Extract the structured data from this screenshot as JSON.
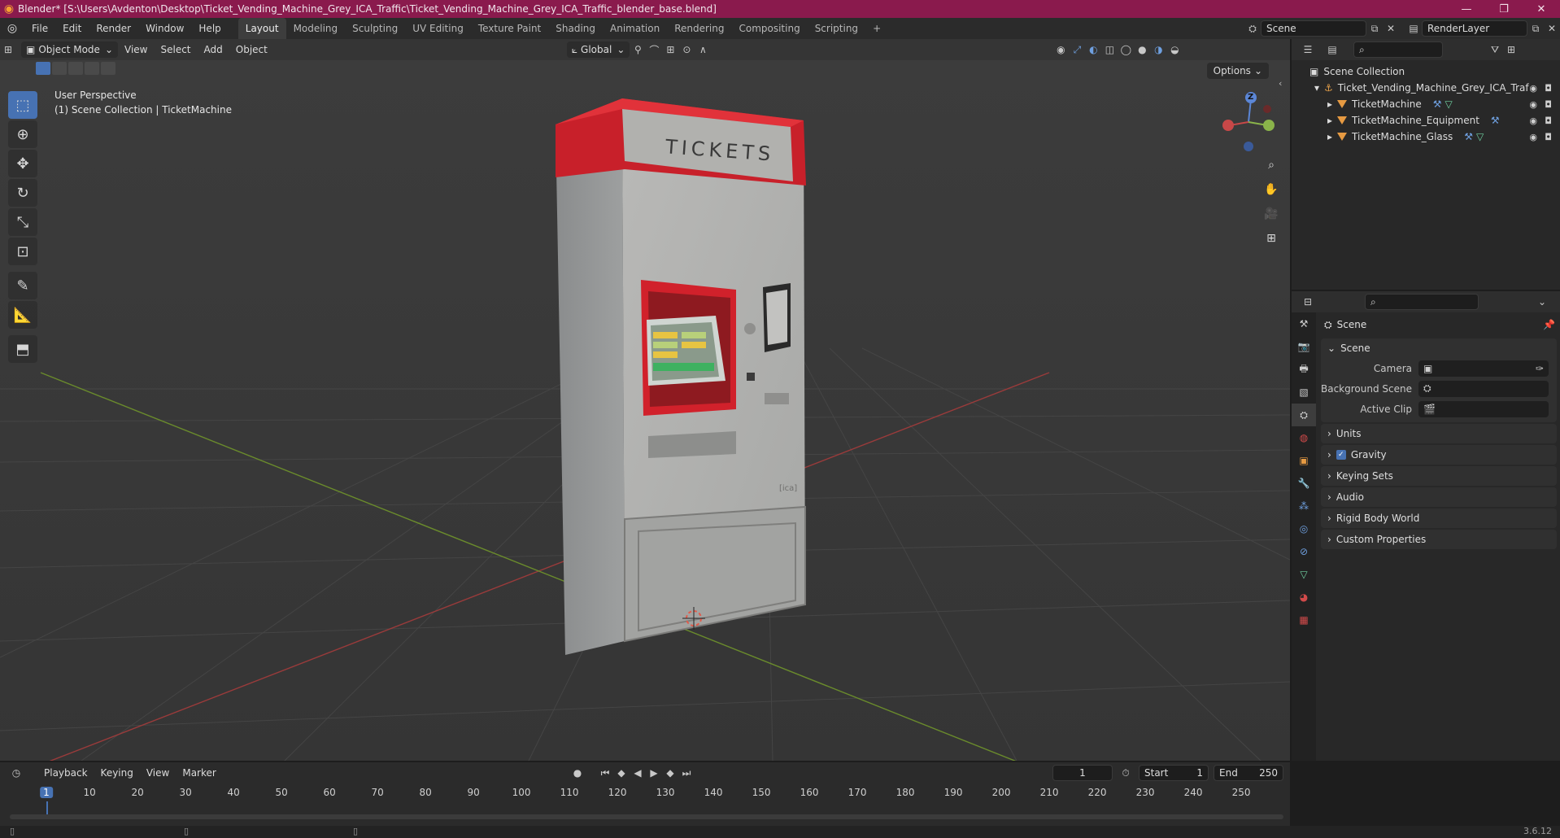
{
  "window": {
    "title": "Blender* [S:\\Users\\Avdenton\\Desktop\\Ticket_Vending_Machine_Grey_ICA_Traffic\\Ticket_Vending_Machine_Grey_ICA_Traffic_blender_base.blend]",
    "minimize": "—",
    "maximize": "❐",
    "close": "✕"
  },
  "menu": [
    "File",
    "Edit",
    "Render",
    "Window",
    "Help"
  ],
  "workspaces": [
    "Layout",
    "Modeling",
    "Sculpting",
    "UV Editing",
    "Texture Paint",
    "Shading",
    "Animation",
    "Rendering",
    "Compositing",
    "Scripting"
  ],
  "active_workspace": "Layout",
  "add_workspace": "+",
  "scene_field": "Scene",
  "renderlayer_field": "RenderLayer",
  "viewport": {
    "mode": "Object Mode",
    "menus": [
      "View",
      "Select",
      "Add",
      "Object"
    ],
    "orientation": "Global",
    "options": "Options",
    "perspective": "User Perspective",
    "collection_info": "(1) Scene Collection | TicketMachine",
    "gizmo_z": "Z",
    "machine_label": "TICKETS"
  },
  "outliner": {
    "root": "Scene Collection",
    "collection": "Ticket_Vending_Machine_Grey_ICA_Traf",
    "objects": [
      "TicketMachine",
      "TicketMachine_Equipment",
      "TicketMachine_Glass"
    ]
  },
  "properties": {
    "context_title": "Scene",
    "panel_title": "Scene",
    "rows": [
      {
        "label": "Camera",
        "value": ""
      },
      {
        "label": "Background Scene",
        "value": ""
      },
      {
        "label": "Active Clip",
        "value": ""
      }
    ],
    "collapsed_panels": [
      "Units",
      "Gravity",
      "Keying Sets",
      "Audio",
      "Rigid Body World",
      "Custom Properties"
    ],
    "gravity_checked": true
  },
  "timeline": {
    "menus": [
      "Playback",
      "Keying",
      "View",
      "Marker"
    ],
    "current_frame": "1",
    "start_label": "Start",
    "start": "1",
    "end_label": "End",
    "end": "250",
    "ticks": [
      "1",
      "10",
      "20",
      "30",
      "40",
      "50",
      "60",
      "70",
      "80",
      "90",
      "100",
      "110",
      "120",
      "130",
      "140",
      "150",
      "160",
      "170",
      "180",
      "190",
      "200",
      "210",
      "220",
      "230",
      "240",
      "250"
    ]
  },
  "status": {
    "version": "3.6.12"
  },
  "colors": {
    "titlebar": "#8a1a4d",
    "accent": "#4772b3",
    "machine_red": "#c8202a"
  }
}
